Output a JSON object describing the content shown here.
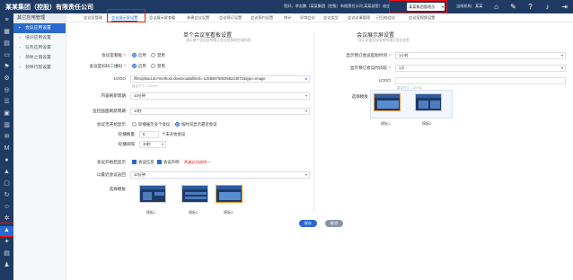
{
  "app": {
    "brand": "某某集团（控股）有限责任公司",
    "greeting": "您好，李志鹏（某某集团（控股）有限责任公司,某某部室）退出",
    "role_select": "某某集团管理员",
    "current_institution": "当前机构：某某",
    "top_icons": [
      "home-icon",
      "wrench-icon",
      "help-icon",
      "bell-icon",
      "logout-icon"
    ]
  },
  "sidebar": {
    "heading": "其它应用管理",
    "items": [
      {
        "label": "会议应用设置",
        "active": true
      },
      {
        "label": "培训应用设置",
        "active": false
      },
      {
        "label": "任务应用设置",
        "active": false
      },
      {
        "label": "领导之窗设置",
        "active": false
      },
      {
        "label": "领导行程设置",
        "active": false
      }
    ]
  },
  "tabs": [
    {
      "label": "会议室管理",
      "active": false
    },
    {
      "label": "会议展示屏设置",
      "active": true
    },
    {
      "label": "会议展示屏查看",
      "active": false
    },
    {
      "label": "参建会议设置",
      "active": false
    },
    {
      "label": "会议预订设置",
      "active": false
    },
    {
      "label": "会议预约设置",
      "active": false
    },
    {
      "label": "统计",
      "active": false
    },
    {
      "label": "异常会议",
      "active": false
    },
    {
      "label": "会议类型",
      "active": false
    },
    {
      "label": "会议议事管理",
      "active": false
    },
    {
      "label": "已归档会议",
      "active": false
    },
    {
      "label": "会议室视频设置",
      "active": false
    }
  ],
  "left_panel": {
    "title": "单个会议室看板设置",
    "subtitle": "显示单个会议室所预订会议信息和空闲时段",
    "fields": {
      "enable_label": "会议室看板",
      "enable_on": "启用",
      "enable_off": "禁用",
      "qr_label": "会议室扫码二维码",
      "qr_on": "启用",
      "qr_off": "禁用",
      "logo_label": "LOGO",
      "logo_value": "/fileUpload.do?method=download&fileId=-1258597580358223072&type=image",
      "logo_hint": "建议尺寸：120*40",
      "content_refresh_label": "内容刷新周期",
      "content_refresh_value": "10分钟",
      "page_switch_label": "监控画面刷新周期",
      "page_switch_value": "10秒",
      "meeting_none_label": "会议无开始显示",
      "meeting_none_opt1": "轮播展示多个会议",
      "meeting_none_opt2": "按时间显示最近会议",
      "carousel_count_label": "轮播数量",
      "carousel_count_value": "5",
      "carousel_count_unit": "个未开始会议",
      "carousel_interval_label": "轮播间隔",
      "carousel_interval_value": "10秒",
      "start_show_label": "会议开始后显示",
      "start_show_opt1": "会议信息",
      "start_show_opt2": "会议声明",
      "start_show_warn": "两者必须选择一",
      "return_period_label": "以最近会议返回",
      "return_period_value": "10分钟",
      "template_label": "选择模板",
      "templates": [
        "模板1",
        "模板2",
        "模板3"
      ]
    }
  },
  "right_panel": {
    "title": "会议展示屏设置",
    "subtitle": "显示全部会议室的所预订会议信息",
    "fields": {
      "time_window_label": "显示预订会议起始时间",
      "time_window_value": "1小时",
      "lookahead_label": "显示预订会议时间段",
      "lookahead_value": "1天",
      "logo_label": "LOGO",
      "logo_hint": "建议尺寸：120*40",
      "template_label": "选择模板",
      "templates": [
        "模板1",
        "模板2"
      ]
    }
  },
  "actions": {
    "save": "保存",
    "cancel": "取消"
  }
}
